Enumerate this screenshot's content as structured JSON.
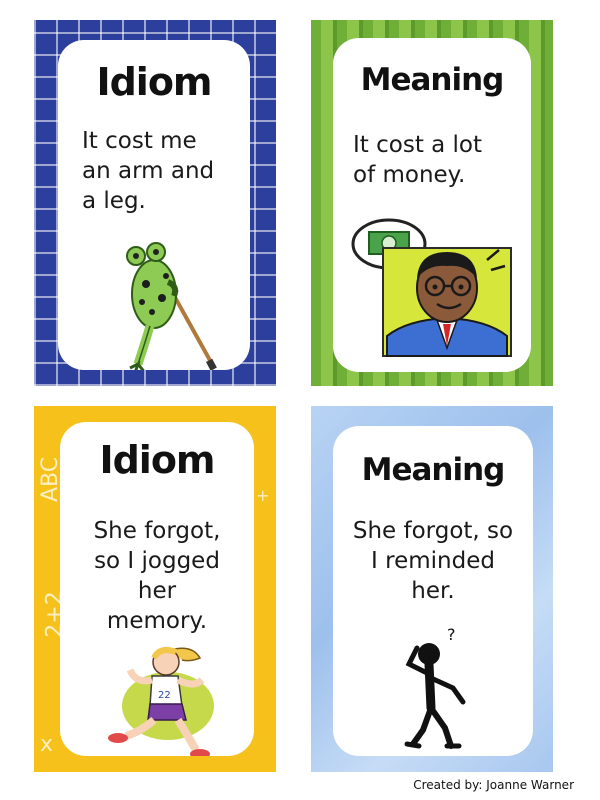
{
  "cards": [
    {
      "heading": "Idiom",
      "lines": [
        "It cost me",
        "an arm and",
        "a leg."
      ],
      "image_icon": "frog-with-crutch-icon",
      "border_color": "#2c3f9c"
    },
    {
      "heading": "Meaning",
      "lines": [
        "It cost a lot",
        "of money."
      ],
      "image_icon": "man-thinking-money-icon",
      "border_color": "#6fae37"
    },
    {
      "heading": "Idiom",
      "lines": [
        "She forgot,",
        "so I jogged",
        "her",
        "memory."
      ],
      "image_icon": "girl-jogging-icon",
      "border_color": "#f6c11b"
    },
    {
      "heading": "Meaning",
      "lines": [
        "She forgot, so",
        "I reminded",
        "her."
      ],
      "image_icon": "stick-figure-scratching-head-icon",
      "border_color": "#a8c7ef"
    }
  ],
  "card3_decor": [
    "ABC",
    "2+2",
    "+",
    "x"
  ],
  "question_mark": "?",
  "credit": "Created by: Joanne Warner"
}
